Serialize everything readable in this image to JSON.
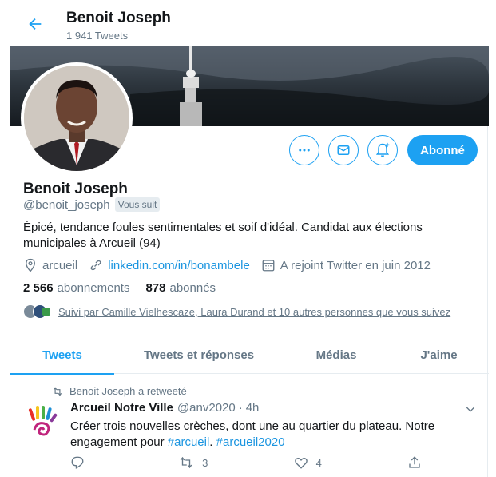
{
  "header": {
    "name": "Benoit Joseph",
    "tweet_count": "1 941 Tweets"
  },
  "profile": {
    "name": "Benoit Joseph",
    "handle": "@benoit_joseph",
    "follows_you": "Vous suit",
    "bio": "Épicé, tendance foules sentimentales et soif d'idéal. Candidat aux élections municipales à Arcueil (94)",
    "location": "arcueil",
    "website": "linkedin.com/in/bonambele",
    "joined": "A rejoint Twitter en juin 2012",
    "following_count": "2 566",
    "following_label": "abonnements",
    "followers_count": "878",
    "followers_label": "abonnés",
    "followed_by": "Suivi par Camille Vielhescaze, Laura Durand et 10 autres personnes que vous suivez",
    "follow_button": "Abonné"
  },
  "tabs": [
    {
      "label": "Tweets",
      "active": true
    },
    {
      "label": "Tweets et réponses",
      "active": false
    },
    {
      "label": "Médias",
      "active": false
    },
    {
      "label": "J'aime",
      "active": false
    }
  ],
  "tweet": {
    "retweeted_by": "Benoit Joseph a retweeté",
    "author": "Arcueil Notre Ville",
    "handle": "@anv2020",
    "dot": "·",
    "time": "4h",
    "text_1": "Créer trois nouvelles crèches, dont une au quartier du plateau. Notre engagement pour ",
    "hashtag_1": "#arcueil",
    "text_2": ". ",
    "hashtag_2": "#arcueil2020",
    "replies": "",
    "retweets": "3",
    "likes": "4"
  },
  "colors": {
    "accent": "#1da1f2",
    "link": "#1b95e0",
    "muted": "#657786",
    "text": "#14171a"
  },
  "icons": [
    "back-arrow-icon",
    "more-icon",
    "message-icon",
    "bell-plus-icon",
    "location-icon",
    "link-icon",
    "calendar-icon",
    "retweet-icon",
    "chevron-down-icon",
    "reply-icon",
    "like-icon",
    "share-icon"
  ]
}
